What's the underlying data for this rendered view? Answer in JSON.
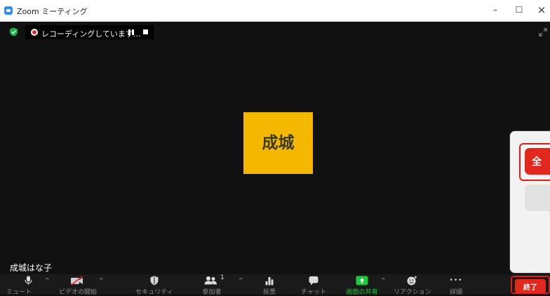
{
  "window": {
    "title": "Zoom ミーティング",
    "minimize": "–",
    "maximize": "☐",
    "close": "×"
  },
  "recording": {
    "status_text": "レコーディングしています..."
  },
  "video": {
    "avatar_text": "成城",
    "avatar_color": "#f5b800",
    "participant_name": "成城はな子"
  },
  "end_popup": {
    "end_all_label": "全"
  },
  "toolbar": {
    "mute_label": "ミュート",
    "video_label": "ビデオの開始",
    "security_label": "セキュリティ",
    "participants_label": "参加者",
    "participants_count": "1",
    "polls_label": "投票",
    "chat_label": "チャット",
    "share_label": "画面の共有",
    "reactions_label": "リアクション",
    "more_label": "詳細",
    "more_glyph": "•••",
    "end_label": "終了",
    "caret": "^"
  },
  "colors": {
    "background": "#111111",
    "share_accent": "#20c840",
    "end_red": "#e0281c",
    "zoom_blue": "#2d8cff"
  }
}
